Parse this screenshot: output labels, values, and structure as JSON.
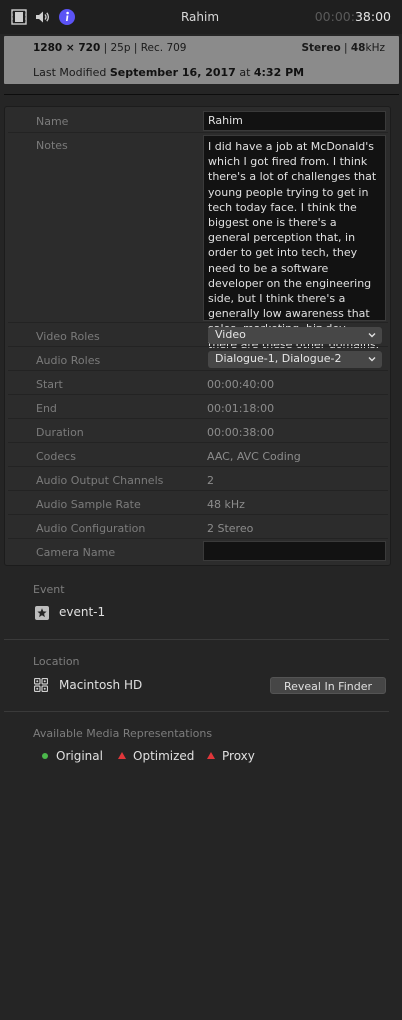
{
  "toolbar": {
    "title": "Rahim",
    "timecode_dim": "00:00:",
    "timecode_bright": "38:00",
    "icons": [
      "film-icon",
      "speaker-icon",
      "info-icon"
    ],
    "info_color": "#5b53f5"
  },
  "header": {
    "resolution": "1280 × 720",
    "format_rest": " | 25p | Rec. 709",
    "audio_bold": "Stereo",
    "audio_rest": " | ",
    "rate_bold": "48",
    "rate_unit": "kHz",
    "modified_prefix": "Last Modified ",
    "modified_date": "September 16, 2017",
    "modified_at": " at ",
    "modified_time": "4:32 PM"
  },
  "properties": {
    "name_label": "Name",
    "name_value": "Rahim",
    "notes_label": "Notes",
    "notes_value": "I did have a job at McDonald's which I got fired from. I think there's a lot of challenges that young people trying to get in tech today face. I think the biggest one is there's a general perception that, in order to get into tech, they need to be a software developer on the engineering side, but I think there's a generally low awareness that sales, marketing, biz dev - there are these other domains.",
    "video_roles_label": "Video Roles",
    "video_roles_value": "Video",
    "audio_roles_label": "Audio Roles",
    "audio_roles_value": "Dialogue-1, Dialogue-2",
    "start_label": "Start",
    "start_value": "00:00:40:00",
    "end_label": "End",
    "end_value": "00:01:18:00",
    "duration_label": "Duration",
    "duration_value": "00:00:38:00",
    "codecs_label": "Codecs",
    "codecs_value": "AAC, AVC Coding",
    "channels_label": "Audio Output Channels",
    "channels_value": "2",
    "sample_rate_label": "Audio Sample Rate",
    "sample_rate_value": "48 kHz",
    "config_label": "Audio Configuration",
    "config_value": "2 Stereo",
    "camera_label": "Camera Name",
    "camera_value": ""
  },
  "event": {
    "label": "Event",
    "value": "event-1"
  },
  "location": {
    "label": "Location",
    "value": "Macintosh HD",
    "button": "Reveal In Finder"
  },
  "representations": {
    "label": "Available Media Representations",
    "items": [
      {
        "name": "Original",
        "status_color": "#4bb84b"
      },
      {
        "name": "Optimized",
        "status_color": "#e0363a"
      },
      {
        "name": "Proxy",
        "status_color": "#e0363a"
      }
    ]
  }
}
